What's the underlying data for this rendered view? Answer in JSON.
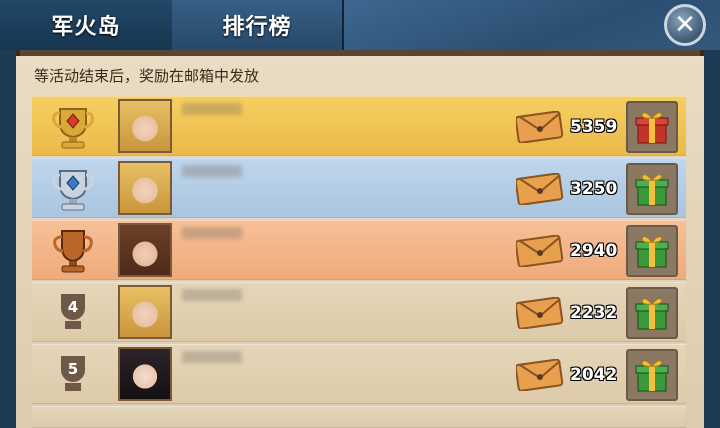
{
  "header": {
    "tabs": [
      {
        "label": "军火岛",
        "active": true
      },
      {
        "label": "排行榜",
        "active": false
      }
    ],
    "close_glyph": "✕"
  },
  "notice": "等活动结束后，奖励在邮箱中发放",
  "ranking": {
    "rows": [
      {
        "rank": 1,
        "rank_icon": "gold-trophy-icon",
        "avatar": "blonde-woman-avatar",
        "score": "5359",
        "reward_icon": "red-gift-box-icon",
        "row_color": "#f1c554"
      },
      {
        "rank": 2,
        "rank_icon": "silver-trophy-icon",
        "avatar": "blonde-woman-avatar",
        "score": "3250",
        "reward_icon": "green-gift-box-icon",
        "row_color": "#b6cfe7"
      },
      {
        "rank": 3,
        "rank_icon": "bronze-trophy-icon",
        "avatar": "brown-hair-woman-avatar",
        "score": "2940",
        "reward_icon": "green-gift-box-icon",
        "row_color": "#f3b78a"
      },
      {
        "rank": "4",
        "rank_icon": "rank-badge-icon",
        "avatar": "blonde-woman-avatar",
        "score": "2232",
        "reward_icon": "green-gift-box-icon",
        "row_color": "#e1d1b3"
      },
      {
        "rank": "5",
        "rank_icon": "rank-badge-icon",
        "avatar": "dark-hair-woman-avatar",
        "score": "2042",
        "reward_icon": "green-gift-box-icon",
        "row_color": "#e1d1b3"
      }
    ]
  },
  "colors": {
    "header_bg": "#27496a",
    "panel_frame": "#5a4434",
    "panel_bg": "#e3d3b7"
  }
}
